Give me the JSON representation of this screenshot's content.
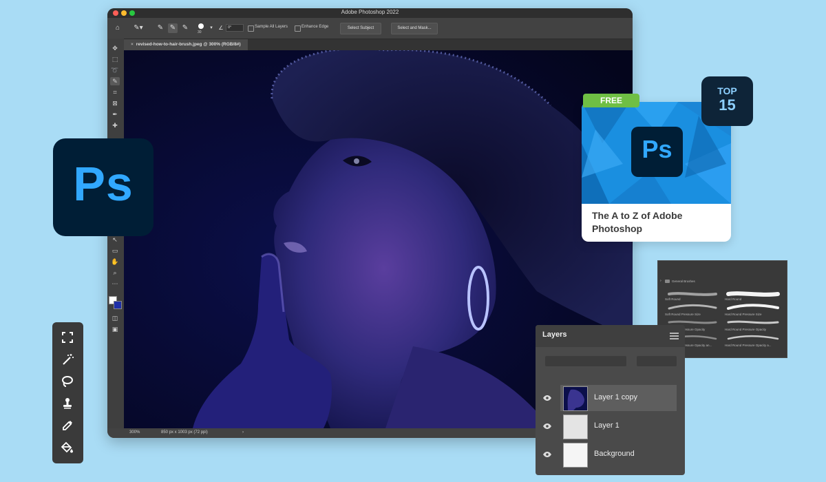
{
  "window": {
    "title": "Adobe Photoshop 2022",
    "document_tab": "revised-how-to-hair-brush.jpeg @ 300% (RGB/8#)",
    "status_zoom": "300%",
    "status_info": "850 px x 1003 px (72 ppi)"
  },
  "options_bar": {
    "brush_size": "30",
    "angle": "0°",
    "sample_all_layers": "Sample All Layers",
    "enhance_edge": "Enhance Edge",
    "select_subject": "Select Subject",
    "select_and_mask": "Select and Mask..."
  },
  "logo": {
    "text": "Ps"
  },
  "card": {
    "badge_free": "FREE",
    "badge_top_line1": "TOP",
    "badge_top_line2": "15",
    "logo_text": "Ps",
    "title": "The A to Z of Adobe Photoshop"
  },
  "brushes": {
    "group": "General Brushes",
    "items": [
      "Soft Round",
      "Hard Round",
      "Soft Round Pressure Size",
      "Hard Round Pressure Size",
      "Soft Round Pressure Opacity",
      "Hard Round Pressure Opacity",
      "Soft Round Pressure Opacity an...",
      "Hard Round Pressure Opacity a..."
    ]
  },
  "layers": {
    "title": "Layers",
    "items": [
      "Layer 1 copy",
      "Layer 1",
      "Background"
    ]
  },
  "colors": {
    "background": "#a9dcf5",
    "ps_dark": "#001e36",
    "ps_blue": "#31a8ff",
    "free_green": "#6fbf44"
  }
}
